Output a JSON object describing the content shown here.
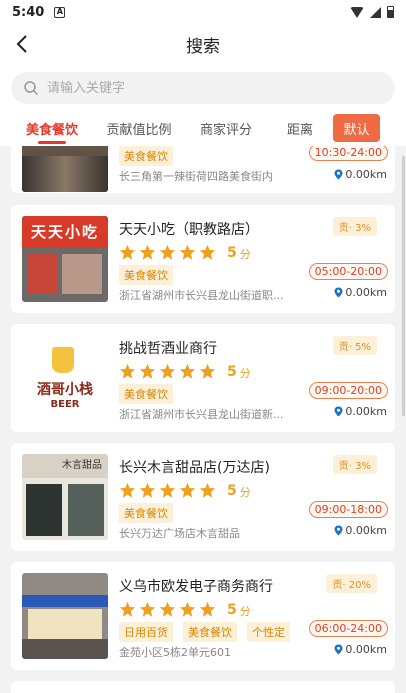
{
  "status": {
    "time": "5:40",
    "a_badge": "A"
  },
  "header": {
    "title": "搜索"
  },
  "search": {
    "placeholder": "请输入关键字"
  },
  "tabs": [
    {
      "label": "美食餐饮"
    },
    {
      "label": "贡献值比例"
    },
    {
      "label": "商家评分"
    },
    {
      "label": "距离"
    }
  ],
  "sort_button": "默认",
  "score_unit": "分",
  "shops": [
    {
      "name": "",
      "tags": [
        "美食餐饮"
      ],
      "address": "长三角第一辣街荷四路美食街内",
      "hours": "10:30-24:00",
      "distance": "0.00km",
      "contribution": "",
      "score": ""
    },
    {
      "name": "天天小吃（职教路店）",
      "tags": [
        "美食餐饮"
      ],
      "address": "浙江省湖州市长兴县龙山街道职...",
      "hours": "05:00-20:00",
      "distance": "0.00km",
      "contribution": "贡· 3%",
      "score": "5"
    },
    {
      "name": "挑战哲酒业商行",
      "tags": [
        "美食餐饮"
      ],
      "address": "浙江省湖州市长兴县龙山街道新...",
      "hours": "09:00-20:00",
      "distance": "0.00km",
      "contribution": "贡· 5%",
      "score": "5"
    },
    {
      "name": "长兴木言甜品店(万达店)",
      "tags": [
        "美食餐饮"
      ],
      "address": "长兴万达广场店木言甜品",
      "hours": "09:00-18:00",
      "distance": "0.00km",
      "contribution": "贡· 3%",
      "score": "5"
    },
    {
      "name": "义乌市欧发电子商务商行",
      "tags": [
        "日用百货",
        "美食餐饮",
        "个性定"
      ],
      "address": "金苑小区5栋2单元601",
      "hours": "06:00-24:00",
      "distance": "0.00km",
      "contribution": "贡· 20%",
      "score": "5"
    }
  ],
  "thumb_text": {
    "shop2_sign": "天天小吃",
    "shop3_logo": "酒哥小栈",
    "shop3_beer": "BEER",
    "shop4_sign": "木言甜品"
  },
  "colors": {
    "accent": "#e5372a",
    "sort": "#f06a44",
    "star": "#f0a020",
    "tag_bg": "#fdf0d9"
  }
}
